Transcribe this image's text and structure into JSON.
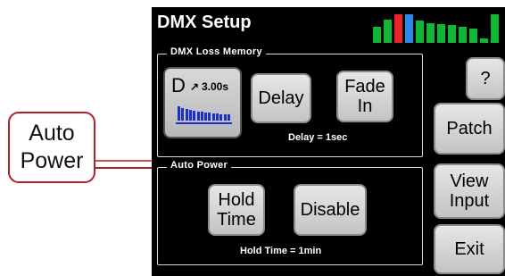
{
  "callout": {
    "line1": "Auto",
    "line2": "Power"
  },
  "header": {
    "title": "DMX Setup"
  },
  "level_meter": {
    "bars": [
      {
        "level": 0.5,
        "color": "#13b534"
      },
      {
        "level": 0.72,
        "color": "#13b534"
      },
      {
        "level": 0.88,
        "color": "#e3252a"
      },
      {
        "level": 0.88,
        "color": "#2a8ae8"
      },
      {
        "level": 0.7,
        "color": "#13b534"
      },
      {
        "level": 0.62,
        "color": "#13b534"
      },
      {
        "level": 0.58,
        "color": "#13b534"
      },
      {
        "level": 0.55,
        "color": "#13b534"
      },
      {
        "level": 0.5,
        "color": "#13b534"
      },
      {
        "level": 0.45,
        "color": "#13b534"
      },
      {
        "level": 0.15,
        "color": "#13b534"
      },
      {
        "level": 0.88,
        "color": "#13b534"
      }
    ]
  },
  "dmx_loss": {
    "title": "DMX Loss Memory",
    "mode_button": {
      "letter": "D",
      "arrow": "↗",
      "time": "3.00s"
    },
    "delay_label": "Delay",
    "fade_in_line1": "Fade",
    "fade_in_line2": "In",
    "status": "Delay = 1sec"
  },
  "auto_power": {
    "title": "Auto Power",
    "hold_time_line1": "Hold",
    "hold_time_line2": "Time",
    "disable_label": "Disable",
    "status": "Hold Time = 1min"
  },
  "side_buttons": {
    "help": "?",
    "patch": "Patch",
    "view_input_line1": "View",
    "view_input_line2": "Input",
    "exit": "Exit"
  },
  "colors": {
    "callout_border": "#b02028",
    "fade_graphic": "#1a30c8"
  }
}
